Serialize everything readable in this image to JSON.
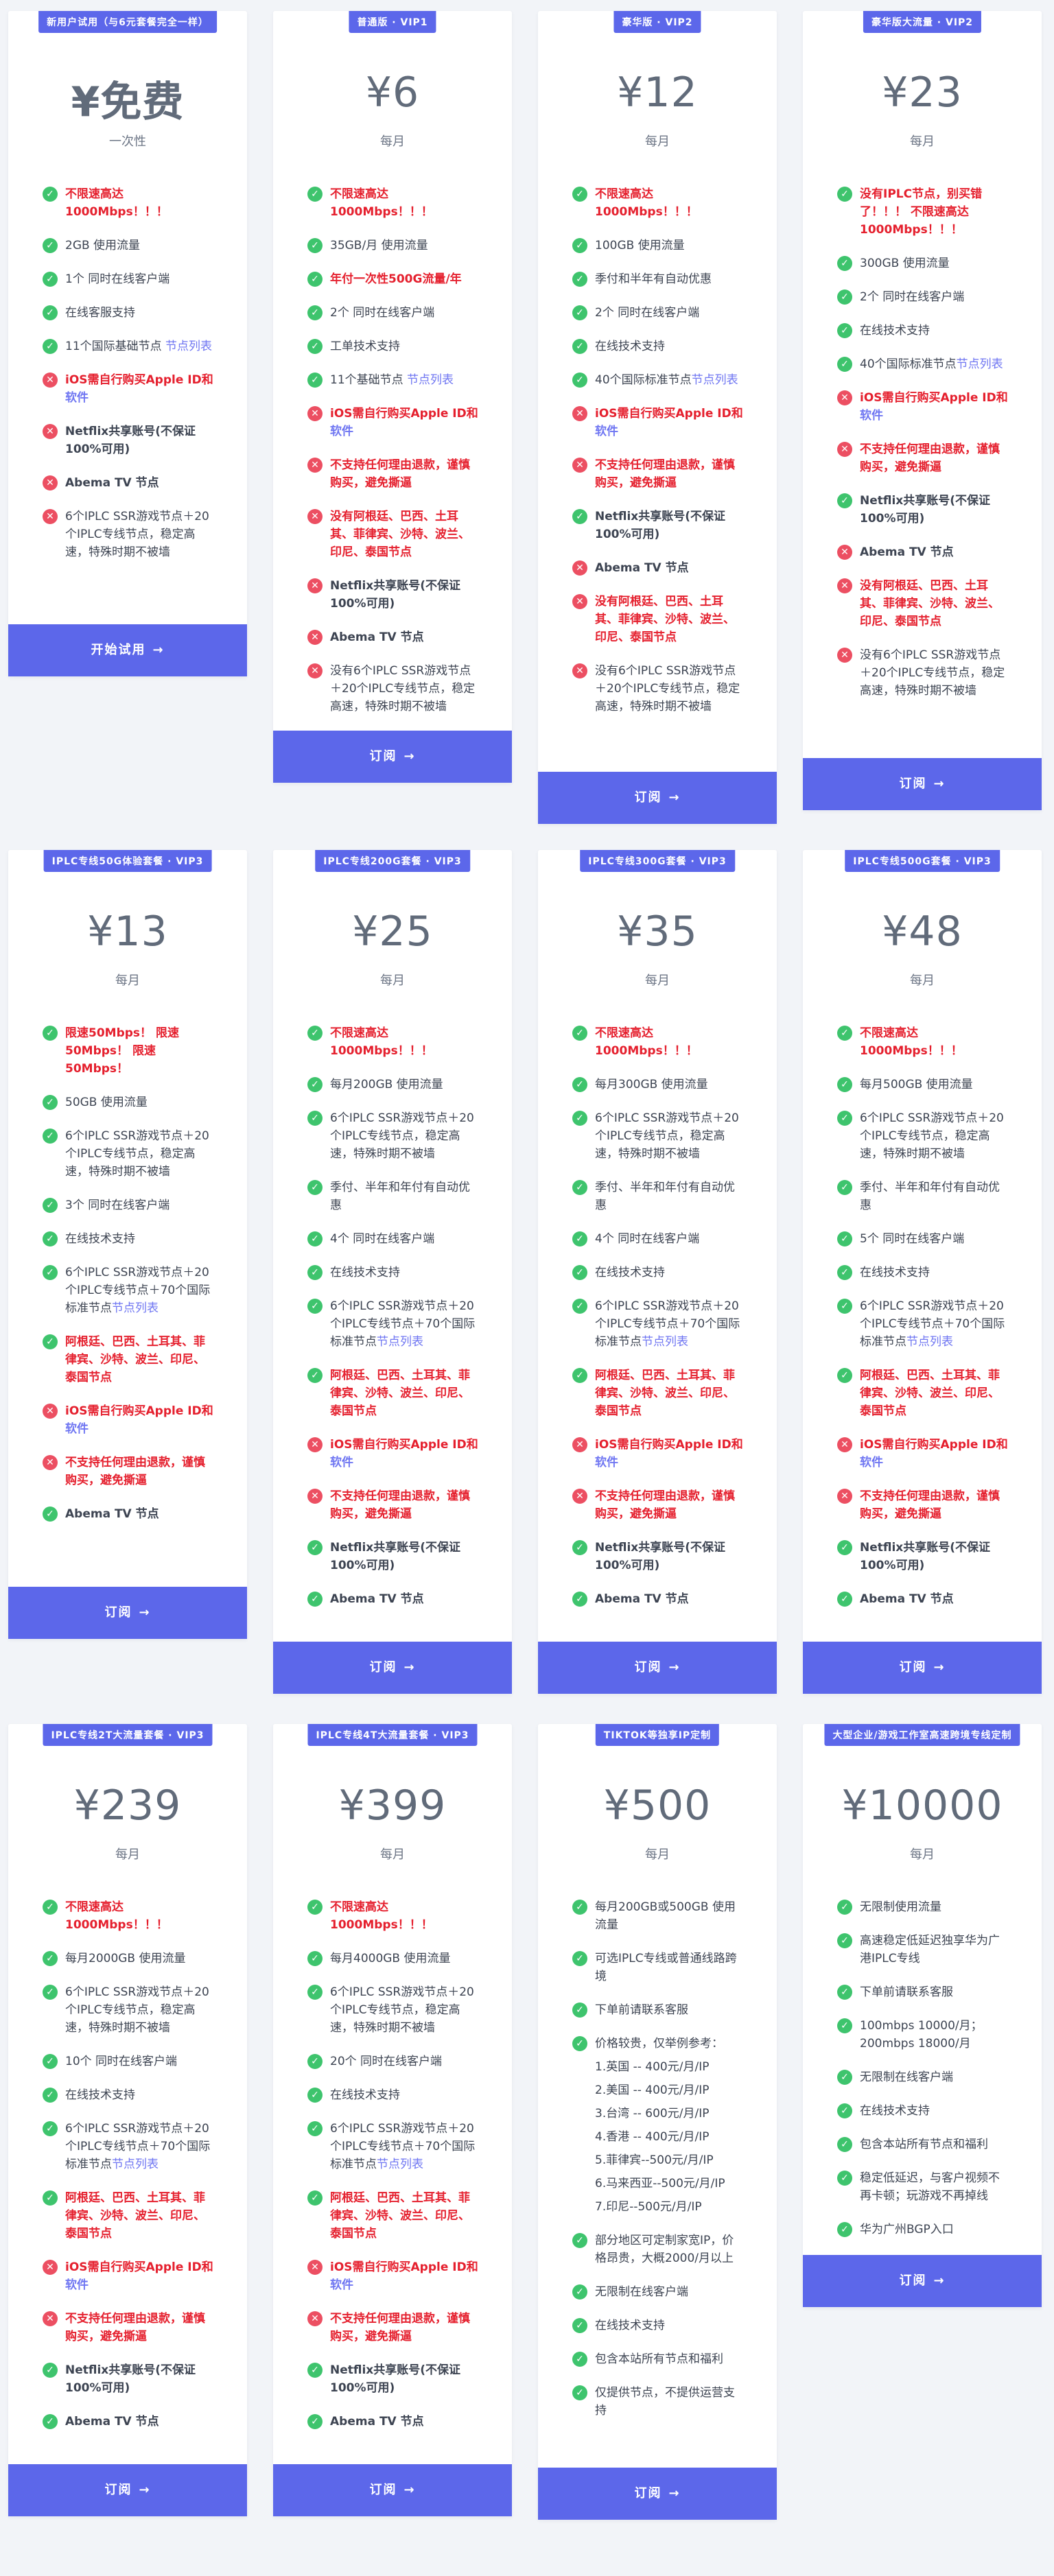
{
  "colors": {
    "accent": "#5c67ea",
    "ok": "#3ec46d",
    "no": "#ec4f62",
    "alert": "#e5202e",
    "link": "#6f76f2"
  },
  "plans": [
    {
      "badge": "新用户试用（与6元套餐完全一样）",
      "price": "¥免费",
      "period": "一次性",
      "button": "开始试用",
      "features": [
        {
          "icon": "check",
          "text": "不限速高达1000Mbps！！！",
          "style": "red"
        },
        {
          "icon": "check",
          "text": "2GB 使用流量"
        },
        {
          "icon": "check",
          "text": "1个 同时在线客户端"
        },
        {
          "icon": "check",
          "text": "在线客服支持"
        },
        {
          "icon": "check",
          "text": "11个国际基础节点 ",
          "link": "节点列表"
        },
        {
          "icon": "cross",
          "text": "iOS需自行购买Apple ID和",
          "link": "软件",
          "style": "red"
        },
        {
          "icon": "cross",
          "text": "Netflix共享账号(不保证100%可用)",
          "style": "dark"
        },
        {
          "icon": "cross",
          "text": "Abema TV 节点",
          "style": "dark"
        },
        {
          "icon": "cross",
          "text": "6个IPLC SSR游戏节点＋20个IPLC专线节点，稳定高速，特殊时期不被墙"
        }
      ]
    },
    {
      "badge": "普通版 · VIP1",
      "price": "¥6",
      "period": "每月",
      "button": "订阅",
      "features": [
        {
          "icon": "check",
          "text": "不限速高达1000Mbps！！！",
          "style": "red"
        },
        {
          "icon": "check",
          "text": "35GB/月 使用流量"
        },
        {
          "icon": "check",
          "text": "年付一次性500G流量/年",
          "style": "red"
        },
        {
          "icon": "check",
          "text": "2个 同时在线客户端"
        },
        {
          "icon": "check",
          "text": "工单技术支持"
        },
        {
          "icon": "check",
          "text": "11个基础节点 ",
          "link": "节点列表"
        },
        {
          "icon": "cross",
          "text": "iOS需自行购买Apple ID和",
          "link": "软件",
          "style": "red"
        },
        {
          "icon": "cross",
          "text": "不支持任何理由退款，谨慎购买，避免撕逼",
          "style": "red"
        },
        {
          "icon": "cross",
          "text": "没有阿根廷、巴西、土耳其、菲律宾、沙特、波兰、印尼、泰国节点",
          "style": "red"
        },
        {
          "icon": "cross",
          "text": "Netflix共享账号(不保证100%可用)",
          "style": "dark"
        },
        {
          "icon": "cross",
          "text": "Abema TV 节点",
          "style": "dark"
        },
        {
          "icon": "cross",
          "text": "没有6个IPLC SSR游戏节点＋20个IPLC专线节点，稳定高速，特殊时期不被墙"
        }
      ]
    },
    {
      "badge": "豪华版 · VIP2",
      "price": "¥12",
      "period": "每月",
      "button": "订阅",
      "features": [
        {
          "icon": "check",
          "text": "不限速高达1000Mbps！！！",
          "style": "red"
        },
        {
          "icon": "check",
          "text": "100GB 使用流量"
        },
        {
          "icon": "check",
          "text": "季付和半年有自动优惠"
        },
        {
          "icon": "check",
          "text": "2个 同时在线客户端"
        },
        {
          "icon": "check",
          "text": "在线技术支持"
        },
        {
          "icon": "check",
          "text": "40个国际标准节点",
          "link": "节点列表"
        },
        {
          "icon": "cross",
          "text": "iOS需自行购买Apple ID和",
          "link": "软件",
          "style": "red"
        },
        {
          "icon": "cross",
          "text": "不支持任何理由退款，谨慎购买，避免撕逼",
          "style": "red"
        },
        {
          "icon": "check",
          "text": "Netflix共享账号(不保证100%可用)",
          "style": "dark"
        },
        {
          "icon": "cross",
          "text": "Abema TV 节点",
          "style": "dark"
        },
        {
          "icon": "cross",
          "text": "没有阿根廷、巴西、土耳其、菲律宾、沙特、波兰、印尼、泰国节点",
          "style": "red"
        },
        {
          "icon": "cross",
          "text": "没有6个IPLC SSR游戏节点＋20个IPLC专线节点，稳定高速，特殊时期不被墙"
        }
      ]
    },
    {
      "badge": "豪华版大流量 · VIP2",
      "price": "¥23",
      "period": "每月",
      "button": "订阅",
      "features": [
        {
          "icon": "check",
          "text": "没有IPLC节点，别买错了！！！ 不限速高达1000Mbps！！！",
          "style": "red"
        },
        {
          "icon": "check",
          "text": "300GB 使用流量"
        },
        {
          "icon": "check",
          "text": "2个 同时在线客户端"
        },
        {
          "icon": "check",
          "text": "在线技术支持"
        },
        {
          "icon": "check",
          "text": "40个国际标准节点",
          "link": "节点列表"
        },
        {
          "icon": "cross",
          "text": "iOS需自行购买Apple ID和",
          "link": "软件",
          "style": "red"
        },
        {
          "icon": "cross",
          "text": "不支持任何理由退款，谨慎购买，避免撕逼",
          "style": "red"
        },
        {
          "icon": "check",
          "text": "Netflix共享账号(不保证100%可用)",
          "style": "dark"
        },
        {
          "icon": "cross",
          "text": "Abema TV 节点",
          "style": "dark"
        },
        {
          "icon": "cross",
          "text": "没有阿根廷、巴西、土耳其、菲律宾、沙特、波兰、印尼、泰国节点",
          "style": "red"
        },
        {
          "icon": "cross",
          "text": "没有6个IPLC SSR游戏节点＋20个IPLC专线节点，稳定高速，特殊时期不被墙"
        }
      ]
    },
    {
      "badge": "IPLC专线50G体验套餐 · VIP3",
      "price": "¥13",
      "period": "每月",
      "button": "订阅",
      "features": [
        {
          "icon": "check",
          "text": "限速50Mbps！ 限速50Mbps！ 限速50Mbps！",
          "style": "red"
        },
        {
          "icon": "check",
          "text": "50GB 使用流量"
        },
        {
          "icon": "check",
          "text": "6个IPLC SSR游戏节点＋20个IPLC专线节点，稳定高速，特殊时期不被墙"
        },
        {
          "icon": "check",
          "text": "3个 同时在线客户端"
        },
        {
          "icon": "check",
          "text": "在线技术支持"
        },
        {
          "icon": "check",
          "text": "6个IPLC SSR游戏节点＋20个IPLC专线节点＋70个国际标准节点",
          "link": "节点列表"
        },
        {
          "icon": "check",
          "text": "阿根廷、巴西、土耳其、菲律宾、沙特、波兰、印尼、泰国节点",
          "style": "red"
        },
        {
          "icon": "cross",
          "text": "iOS需自行购买Apple ID和",
          "link": "软件",
          "style": "red"
        },
        {
          "icon": "cross",
          "text": "不支持任何理由退款，谨慎购买，避免撕逼",
          "style": "red"
        },
        {
          "icon": "check",
          "text": "Abema TV 节点",
          "style": "dark"
        }
      ]
    },
    {
      "badge": "IPLC专线200G套餐 · VIP3",
      "price": "¥25",
      "period": "每月",
      "button": "订阅",
      "features": [
        {
          "icon": "check",
          "text": "不限速高达1000Mbps！！！",
          "style": "red"
        },
        {
          "icon": "check",
          "text": "每月200GB 使用流量"
        },
        {
          "icon": "check",
          "text": "6个IPLC SSR游戏节点＋20个IPLC专线节点，稳定高速，特殊时期不被墙"
        },
        {
          "icon": "check",
          "text": "季付、半年和年付有自动优惠"
        },
        {
          "icon": "check",
          "text": "4个 同时在线客户端"
        },
        {
          "icon": "check",
          "text": "在线技术支持"
        },
        {
          "icon": "check",
          "text": "6个IPLC SSR游戏节点＋20个IPLC专线节点＋70个国际标准节点",
          "link": "节点列表"
        },
        {
          "icon": "check",
          "text": "阿根廷、巴西、土耳其、菲律宾、沙特、波兰、印尼、泰国节点",
          "style": "red"
        },
        {
          "icon": "cross",
          "text": "iOS需自行购买Apple ID和",
          "link": "软件",
          "style": "red"
        },
        {
          "icon": "cross",
          "text": "不支持任何理由退款，谨慎购买，避免撕逼",
          "style": "red"
        },
        {
          "icon": "check",
          "text": "Netflix共享账号(不保证100%可用)",
          "style": "dark"
        },
        {
          "icon": "check",
          "text": "Abema TV 节点",
          "style": "dark"
        }
      ]
    },
    {
      "badge": "IPLC专线300G套餐 · VIP3",
      "price": "¥35",
      "period": "每月",
      "button": "订阅",
      "features": [
        {
          "icon": "check",
          "text": "不限速高达1000Mbps！！！",
          "style": "red"
        },
        {
          "icon": "check",
          "text": "每月300GB 使用流量"
        },
        {
          "icon": "check",
          "text": "6个IPLC SSR游戏节点＋20个IPLC专线节点，稳定高速，特殊时期不被墙"
        },
        {
          "icon": "check",
          "text": "季付、半年和年付有自动优惠"
        },
        {
          "icon": "check",
          "text": "4个 同时在线客户端"
        },
        {
          "icon": "check",
          "text": "在线技术支持"
        },
        {
          "icon": "check",
          "text": "6个IPLC SSR游戏节点＋20个IPLC专线节点＋70个国际标准节点",
          "link": "节点列表"
        },
        {
          "icon": "check",
          "text": "阿根廷、巴西、土耳其、菲律宾、沙特、波兰、印尼、泰国节点",
          "style": "red"
        },
        {
          "icon": "cross",
          "text": "iOS需自行购买Apple ID和",
          "link": "软件",
          "style": "red"
        },
        {
          "icon": "cross",
          "text": "不支持任何理由退款，谨慎购买，避免撕逼",
          "style": "red"
        },
        {
          "icon": "check",
          "text": "Netflix共享账号(不保证100%可用)",
          "style": "dark"
        },
        {
          "icon": "check",
          "text": "Abema TV 节点",
          "style": "dark"
        }
      ]
    },
    {
      "badge": "IPLC专线500G套餐 · VIP3",
      "price": "¥48",
      "period": "每月",
      "button": "订阅",
      "features": [
        {
          "icon": "check",
          "text": "不限速高达1000Mbps！！！",
          "style": "red"
        },
        {
          "icon": "check",
          "text": "每月500GB 使用流量"
        },
        {
          "icon": "check",
          "text": "6个IPLC SSR游戏节点＋20个IPLC专线节点，稳定高速，特殊时期不被墙"
        },
        {
          "icon": "check",
          "text": "季付、半年和年付有自动优惠"
        },
        {
          "icon": "check",
          "text": "5个 同时在线客户端"
        },
        {
          "icon": "check",
          "text": "在线技术支持"
        },
        {
          "icon": "check",
          "text": "6个IPLC SSR游戏节点＋20个IPLC专线节点＋70个国际标准节点",
          "link": "节点列表"
        },
        {
          "icon": "check",
          "text": "阿根廷、巴西、土耳其、菲律宾、沙特、波兰、印尼、泰国节点",
          "style": "red"
        },
        {
          "icon": "cross",
          "text": "iOS需自行购买Apple ID和",
          "link": "软件",
          "style": "red"
        },
        {
          "icon": "cross",
          "text": "不支持任何理由退款，谨慎购买，避免撕逼",
          "style": "red"
        },
        {
          "icon": "check",
          "text": "Netflix共享账号(不保证100%可用)",
          "style": "dark"
        },
        {
          "icon": "check",
          "text": "Abema TV 节点",
          "style": "dark"
        }
      ]
    },
    {
      "badge": "IPLC专线2T大流量套餐 · VIP3",
      "price": "¥239",
      "period": "每月",
      "button": "订阅",
      "features": [
        {
          "icon": "check",
          "text": "不限速高达1000Mbps！！！",
          "style": "red"
        },
        {
          "icon": "check",
          "text": "每月2000GB 使用流量"
        },
        {
          "icon": "check",
          "text": "6个IPLC SSR游戏节点＋20个IPLC专线节点，稳定高速，特殊时期不被墙"
        },
        {
          "icon": "check",
          "text": "10个 同时在线客户端"
        },
        {
          "icon": "check",
          "text": "在线技术支持"
        },
        {
          "icon": "check",
          "text": "6个IPLC SSR游戏节点＋20个IPLC专线节点＋70个国际标准节点",
          "link": "节点列表"
        },
        {
          "icon": "check",
          "text": "阿根廷、巴西、土耳其、菲律宾、沙特、波兰、印尼、泰国节点",
          "style": "red"
        },
        {
          "icon": "cross",
          "text": "iOS需自行购买Apple ID和",
          "link": "软件",
          "style": "red"
        },
        {
          "icon": "cross",
          "text": "不支持任何理由退款，谨慎购买，避免撕逼",
          "style": "red"
        },
        {
          "icon": "check",
          "text": "Netflix共享账号(不保证100%可用)",
          "style": "dark"
        },
        {
          "icon": "check",
          "text": "Abema TV 节点",
          "style": "dark"
        }
      ]
    },
    {
      "badge": "IPLC专线4T大流量套餐 · VIP3",
      "price": "¥399",
      "period": "每月",
      "button": "订阅",
      "features": [
        {
          "icon": "check",
          "text": "不限速高达1000Mbps！！！",
          "style": "red"
        },
        {
          "icon": "check",
          "text": "每月4000GB 使用流量"
        },
        {
          "icon": "check",
          "text": "6个IPLC SSR游戏节点＋20个IPLC专线节点，稳定高速，特殊时期不被墙"
        },
        {
          "icon": "check",
          "text": "20个 同时在线客户端"
        },
        {
          "icon": "check",
          "text": "在线技术支持"
        },
        {
          "icon": "check",
          "text": "6个IPLC SSR游戏节点＋20个IPLC专线节点＋70个国际标准节点",
          "link": "节点列表"
        },
        {
          "icon": "check",
          "text": "阿根廷、巴西、土耳其、菲律宾、沙特、波兰、印尼、泰国节点",
          "style": "red"
        },
        {
          "icon": "cross",
          "text": "iOS需自行购买Apple ID和",
          "link": "软件",
          "style": "red"
        },
        {
          "icon": "cross",
          "text": "不支持任何理由退款，谨慎购买，避免撕逼",
          "style": "red"
        },
        {
          "icon": "check",
          "text": "Netflix共享账号(不保证100%可用)",
          "style": "dark"
        },
        {
          "icon": "check",
          "text": "Abema TV 节点",
          "style": "dark"
        }
      ]
    },
    {
      "badge": "TIKTOK等独享IP定制",
      "price": "¥500",
      "period": "每月",
      "button": "订阅",
      "features": [
        {
          "icon": "check",
          "text": "每月200GB或500GB 使用流量"
        },
        {
          "icon": "check",
          "text": "可选IPLC专线或普通线路跨境"
        },
        {
          "icon": "check",
          "text": "下单前请联系客服"
        },
        {
          "icon": "check",
          "text": "价格较贵，仅举例参考：",
          "sub": [
            "1.英国 -- 400元/月/IP",
            "2.美国 -- 400元/月/IP",
            "3.台湾 -- 600元/月/IP",
            "4.香港 -- 400元/月/IP",
            "5.菲律宾--500元/月/IP",
            "6.马来西亚--500元/月/IP",
            "7.印尼--500元/月/IP"
          ]
        },
        {
          "icon": "check",
          "text": "部分地区可定制家宽IP，价格昂贵，大概2000/月以上"
        },
        {
          "icon": "check",
          "text": "无限制在线客户端"
        },
        {
          "icon": "check",
          "text": "在线技术支持"
        },
        {
          "icon": "check",
          "text": "包含本站所有节点和福利"
        },
        {
          "icon": "check",
          "text": "仅提供节点，不提供运营支持"
        }
      ]
    },
    {
      "badge": "大型企业/游戏工作室高速跨境专线定制",
      "price": "¥10000",
      "period": "每月",
      "button": "订阅",
      "features": [
        {
          "icon": "check",
          "text": "无限制使用流量"
        },
        {
          "icon": "check",
          "text": "高速稳定低延迟独享华为广港IPLC专线"
        },
        {
          "icon": "check",
          "text": "下单前请联系客服"
        },
        {
          "icon": "check",
          "text": "100mbps 10000/月；200mbps 18000/月"
        },
        {
          "icon": "check",
          "text": "无限制在线客户端"
        },
        {
          "icon": "check",
          "text": "在线技术支持"
        },
        {
          "icon": "check",
          "text": "包含本站所有节点和福利"
        },
        {
          "icon": "check",
          "text": "稳定低延迟，与客户视频不再卡顿；玩游戏不再掉线"
        },
        {
          "icon": "check",
          "text": "华为广州BGP入口"
        }
      ]
    }
  ]
}
